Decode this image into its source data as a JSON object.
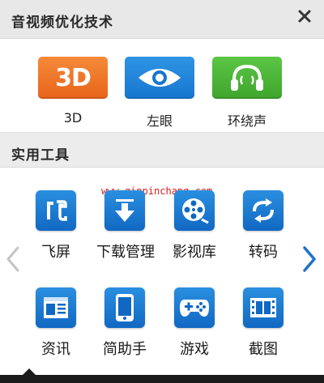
{
  "header": {
    "title": "音视频优化技术",
    "close_icon": "close-icon"
  },
  "av_buttons": [
    {
      "label": "3D",
      "badge": "3D",
      "icon": "3d-icon",
      "color": "#e8641a"
    },
    {
      "label": "左眼",
      "icon": "eye-icon",
      "color": "#1676cf"
    },
    {
      "label": "环绕声",
      "icon": "headphones-icon",
      "color": "#3ea52b"
    }
  ],
  "tools_section": {
    "title": "实用工具"
  },
  "watermark": "www.qinpinchang.com",
  "tools": [
    {
      "label": "飞屏",
      "icon": "fly-screen-icon"
    },
    {
      "label": "下载管理",
      "icon": "download-icon"
    },
    {
      "label": "影视库",
      "icon": "film-reel-icon"
    },
    {
      "label": "转码",
      "icon": "convert-icon"
    },
    {
      "label": "资讯",
      "icon": "news-icon"
    },
    {
      "label": "简助手",
      "icon": "phone-assistant-icon"
    },
    {
      "label": "游戏",
      "icon": "gamepad-icon"
    },
    {
      "label": "截图",
      "icon": "screenshot-film-icon"
    }
  ],
  "nav": {
    "prev_icon": "chevron-left-icon",
    "next_icon": "chevron-right-icon"
  },
  "colors": {
    "accent_blue": "#1676cf",
    "orange": "#e8641a",
    "green": "#3ea52b",
    "arrow_active": "#1e73c8",
    "arrow_inactive": "#c4c4c4"
  }
}
